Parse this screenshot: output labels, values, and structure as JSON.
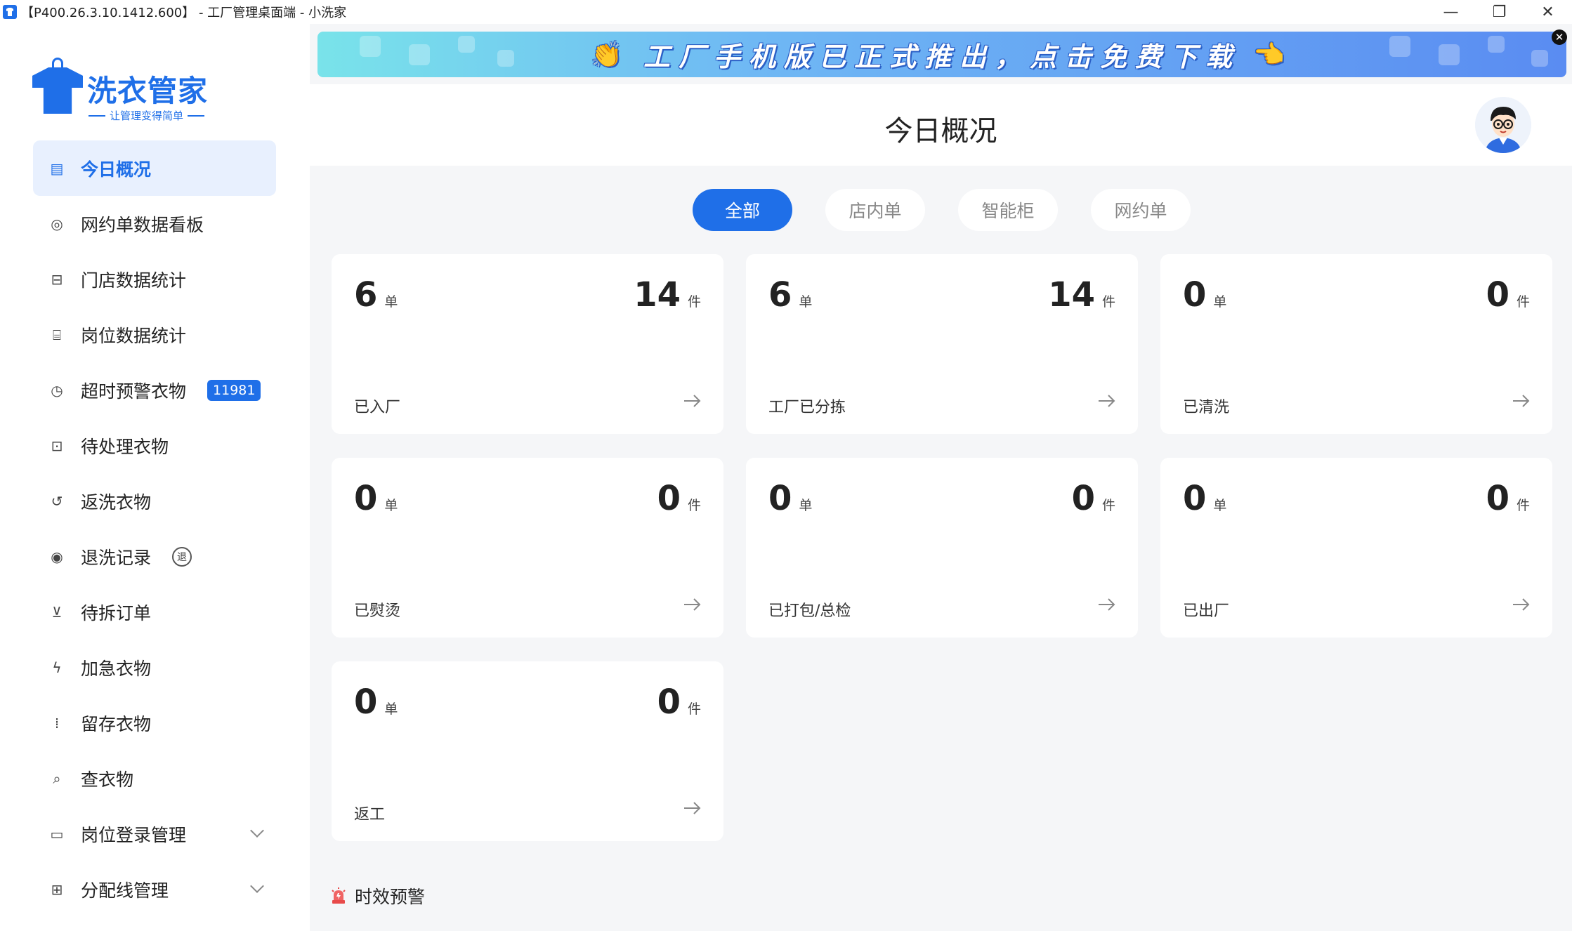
{
  "window": {
    "title": "【P400.26.3.10.1412.600】 - 工厂管理桌面端 - 小洗家",
    "minimize": "—",
    "restore": "❐",
    "close": "✕"
  },
  "logo": {
    "brand": "洗衣管家",
    "slogan": "让管理变得简单"
  },
  "sidebar": {
    "items": [
      {
        "label": "今日概况",
        "icon": "calendar-icon",
        "glyph": "▤",
        "active": true
      },
      {
        "label": "网约单数据看板",
        "icon": "dashboard-icon",
        "glyph": "◎"
      },
      {
        "label": "门店数据统计",
        "icon": "store-icon",
        "glyph": "⊟"
      },
      {
        "label": "岗位数据统计",
        "icon": "chair-icon",
        "glyph": "⌸"
      },
      {
        "label": "超时预警衣物",
        "icon": "clock-icon",
        "glyph": "◷",
        "badge": "11981"
      },
      {
        "label": "待处理衣物",
        "icon": "pending-icon",
        "glyph": "⊡"
      },
      {
        "label": "返洗衣物",
        "icon": "return-icon",
        "glyph": "↺"
      },
      {
        "label": "退洗记录",
        "icon": "refund-icon",
        "glyph": "◉",
        "tag": "退"
      },
      {
        "label": "待拆订单",
        "icon": "split-icon",
        "glyph": "⊻"
      },
      {
        "label": "加急衣物",
        "icon": "lightning-icon",
        "glyph": "ϟ"
      },
      {
        "label": "留存衣物",
        "icon": "storage-icon",
        "glyph": "⁞"
      },
      {
        "label": "查衣物",
        "icon": "search-icon",
        "glyph": "⌕"
      },
      {
        "label": "岗位登录管理",
        "icon": "monitor-icon",
        "glyph": "▭",
        "expandable": true
      },
      {
        "label": "分配线管理",
        "icon": "tree-icon",
        "glyph": "⊞",
        "expandable": true
      }
    ]
  },
  "banner": {
    "text": "工厂手机版已正式推出，点击免费下载",
    "close": "✕"
  },
  "header": {
    "title": "今日概况"
  },
  "tabs": [
    {
      "label": "全部",
      "active": true
    },
    {
      "label": "店内单"
    },
    {
      "label": "智能柜"
    },
    {
      "label": "网约单"
    }
  ],
  "cards": [
    {
      "orders": "6",
      "orders_unit": "单",
      "items": "14",
      "items_unit": "件",
      "label": "已入厂"
    },
    {
      "orders": "6",
      "orders_unit": "单",
      "items": "14",
      "items_unit": "件",
      "label": "工厂已分拣"
    },
    {
      "orders": "0",
      "orders_unit": "单",
      "items": "0",
      "items_unit": "件",
      "label": "已清洗"
    },
    {
      "orders": "0",
      "orders_unit": "单",
      "items": "0",
      "items_unit": "件",
      "label": "已熨烫"
    },
    {
      "orders": "0",
      "orders_unit": "单",
      "items": "0",
      "items_unit": "件",
      "label": "已打包/总检"
    },
    {
      "orders": "0",
      "orders_unit": "单",
      "items": "0",
      "items_unit": "件",
      "label": "已出厂"
    },
    {
      "orders": "0",
      "orders_unit": "单",
      "items": "0",
      "items_unit": "件",
      "label": "返工"
    }
  ],
  "warning": {
    "label": "时效预警"
  },
  "colors": {
    "accent": "#1f6fe8",
    "background": "#f5f6f8",
    "card": "#ffffff"
  }
}
